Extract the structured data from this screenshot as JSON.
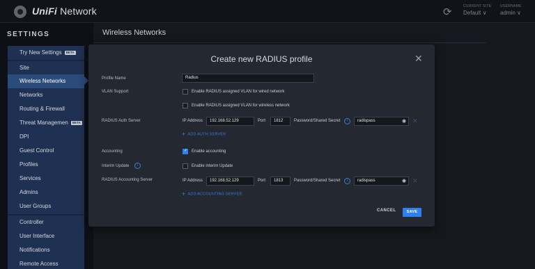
{
  "header": {
    "brand_bold": "UniFi",
    "brand_rest": " Network",
    "refresh_icon": "refresh-icon",
    "current_site_label": "CURRENT SITE",
    "current_site_value": "Default ∨",
    "username_label": "USERNAME",
    "username_value": "admin ∨"
  },
  "sidebar": {
    "title": "SETTINGS",
    "items": [
      {
        "label": "Try New Settings",
        "badge": "BETA"
      },
      {
        "label": "Site"
      },
      {
        "label": "Wireless Networks"
      },
      {
        "label": "Networks"
      },
      {
        "label": "Routing & Firewall"
      },
      {
        "label": "Threat Managemen",
        "badge": "BETA"
      },
      {
        "label": "DPI"
      },
      {
        "label": "Guest Control"
      },
      {
        "label": "Profiles"
      },
      {
        "label": "Services"
      },
      {
        "label": "Admins"
      },
      {
        "label": "User Groups"
      },
      {
        "label": "Controller"
      },
      {
        "label": "User Interface"
      },
      {
        "label": "Notifications"
      },
      {
        "label": "Remote Access"
      }
    ]
  },
  "content": {
    "title": "Wireless Networks"
  },
  "modal": {
    "title": "Create new RADIUS profile",
    "close": "✕",
    "profile_name_label": "Profile Name",
    "profile_name_value": "Radius",
    "vlan_support_label": "VLAN Support",
    "vlan_wired_text": "Enable RADIUS assigned VLAN for wired network",
    "vlan_wireless_text": "Enable RADIUS assigned VLAN for wireless network",
    "auth_server_label": "RADIUS Auth Server",
    "ip_label": "IP Address",
    "auth_ip": "192.168.52.129",
    "port_label": "Port",
    "auth_port": "1812",
    "secret_label": "Password/Shared Secret",
    "auth_secret": "radispass",
    "add_auth": "ADD AUTH SERVER",
    "accounting_label": "Accounting",
    "accounting_text": "Enable accounting",
    "interim_label": "Interim Update",
    "interim_text": "Enable interim Update",
    "acct_server_label": "RADIUS Accounting Server",
    "acct_ip": "192.168.52.129",
    "acct_port": "1813",
    "acct_secret": "radispass",
    "add_acct": "ADD ACCOUNTING SERVER",
    "cancel": "CANCEL",
    "save": "SAVE"
  },
  "colors": {
    "accent": "#2f80ed",
    "sidebar_bg": "#1f3152",
    "sidebar_active": "#2b4b7a",
    "modal_bg": "#232831"
  }
}
